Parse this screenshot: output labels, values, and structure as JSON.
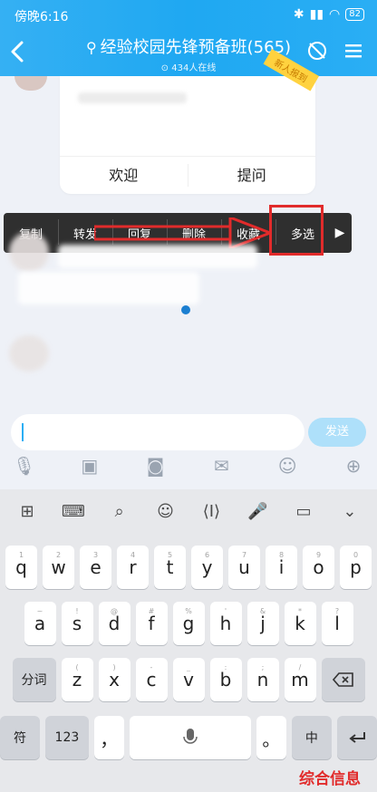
{
  "status": {
    "time": "傍晚6:16",
    "battery": "82"
  },
  "header": {
    "title": "经验校园先锋预备班(565)",
    "subtitle": "434人在线"
  },
  "card": {
    "tag": "新人报到",
    "left_button": "欢迎",
    "right_button": "提问"
  },
  "context_menu": {
    "items": [
      "复制",
      "转发",
      "回复",
      "删除",
      "收藏",
      "多选"
    ]
  },
  "input": {
    "send_label": "发送"
  },
  "keyboard": {
    "row1": [
      {
        "k": "q",
        "s": "1"
      },
      {
        "k": "w",
        "s": "2"
      },
      {
        "k": "e",
        "s": "3"
      },
      {
        "k": "r",
        "s": "4"
      },
      {
        "k": "t",
        "s": "5"
      },
      {
        "k": "y",
        "s": "6"
      },
      {
        "k": "u",
        "s": "7"
      },
      {
        "k": "i",
        "s": "8"
      },
      {
        "k": "o",
        "s": "9"
      },
      {
        "k": "p",
        "s": "0"
      }
    ],
    "row2": [
      {
        "k": "a",
        "s": "~"
      },
      {
        "k": "s",
        "s": "!"
      },
      {
        "k": "d",
        "s": "@"
      },
      {
        "k": "f",
        "s": "#"
      },
      {
        "k": "g",
        "s": "%"
      },
      {
        "k": "h",
        "s": "'"
      },
      {
        "k": "j",
        "s": "&"
      },
      {
        "k": "k",
        "s": "*"
      },
      {
        "k": "l",
        "s": "?"
      }
    ],
    "row3": [
      {
        "k": "z",
        "s": "("
      },
      {
        "k": "x",
        "s": ")"
      },
      {
        "k": "c",
        "s": "-"
      },
      {
        "k": "v",
        "s": "_"
      },
      {
        "k": "b",
        "s": ":"
      },
      {
        "k": "n",
        "s": ";"
      },
      {
        "k": "m",
        "s": "/"
      }
    ],
    "fenci": "分词",
    "fu": "符",
    "num": "123",
    "comma": "，",
    "period": "。",
    "lang": "中"
  },
  "watermark": "综合信息"
}
